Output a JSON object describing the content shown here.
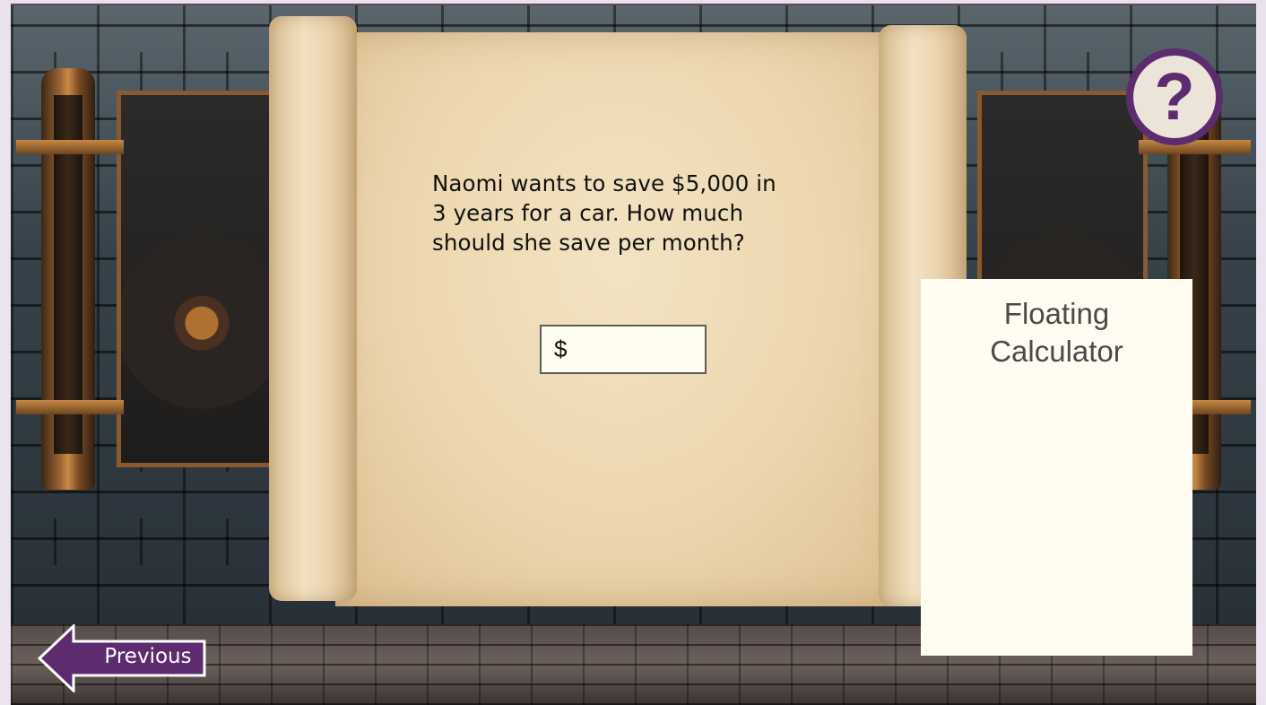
{
  "question": {
    "lines": [
      "Naomi wants to save $5,000 in",
      "3 years for a car. How much",
      "should she save per month?"
    ]
  },
  "answer": {
    "prefix": "$",
    "value": ""
  },
  "calculator": {
    "title_line1": "Floating",
    "title_line2": "Calculator"
  },
  "help": {
    "symbol": "?"
  },
  "navigation": {
    "previous_label": "Previous"
  },
  "colors": {
    "accent_purple": "#5c2c6e",
    "parchment": "#ecd6ae",
    "calculator_bg": "#fffdf1"
  },
  "icons": {
    "help": "question-mark-icon",
    "previous": "left-arrow-icon"
  }
}
